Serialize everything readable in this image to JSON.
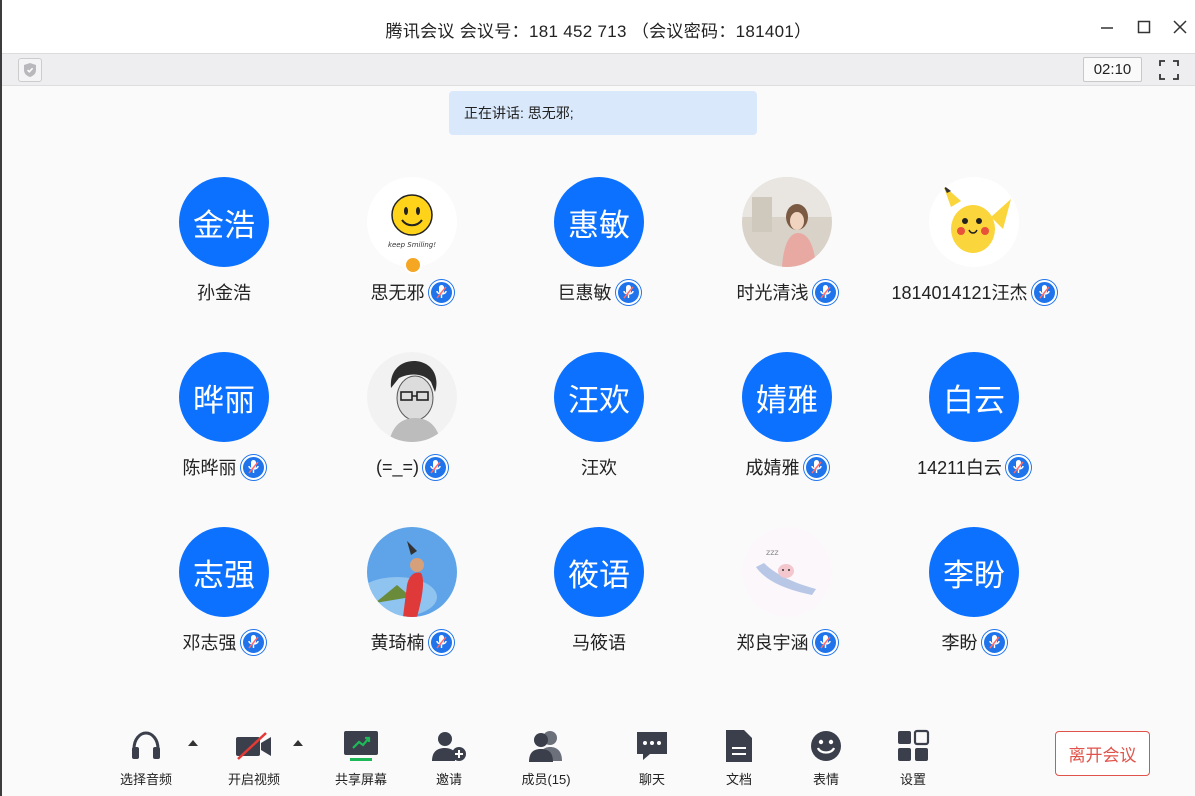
{
  "title": "腾讯会议 会议号：181 452 713 （会议密码：181401）",
  "timer": "02:10",
  "speaking": "正在讲话: 思无邪;",
  "participants": [
    {
      "avatar_text": "金浩",
      "name": "孙金浩",
      "avatar_type": "text",
      "mic": false
    },
    {
      "avatar_text": "",
      "name": "思无邪",
      "avatar_type": "smiley",
      "mic": true,
      "host_badge": true,
      "smile_caption": "keep Smiling!"
    },
    {
      "avatar_text": "惠敏",
      "name": "巨惠敏",
      "avatar_type": "text",
      "mic": true
    },
    {
      "avatar_text": "",
      "name": "时光清浅",
      "avatar_type": "photo-girl",
      "mic": true
    },
    {
      "avatar_text": "",
      "name": "1814014121汪杰",
      "avatar_type": "pikachu",
      "mic": true
    },
    {
      "avatar_text": "晔丽",
      "name": "陈晔丽",
      "avatar_type": "text",
      "mic": true
    },
    {
      "avatar_text": "",
      "name": "(=_=)",
      "avatar_type": "sketch-man",
      "mic": true
    },
    {
      "avatar_text": "汪欢",
      "name": "汪欢",
      "avatar_type": "text",
      "mic": false
    },
    {
      "avatar_text": "婧雅",
      "name": "成婧雅",
      "avatar_type": "text",
      "mic": true
    },
    {
      "avatar_text": "白云",
      "name": "14211白云",
      "avatar_type": "text",
      "mic": true
    },
    {
      "avatar_text": "志强",
      "name": "邓志强",
      "avatar_type": "text",
      "mic": true
    },
    {
      "avatar_text": "",
      "name": "黄琦楠",
      "avatar_type": "photo-sky",
      "mic": true
    },
    {
      "avatar_text": "筱语",
      "name": "马筱语",
      "avatar_type": "text",
      "mic": false
    },
    {
      "avatar_text": "",
      "name": "郑良宇涵",
      "avatar_type": "cartoon-pig",
      "mic": true
    },
    {
      "avatar_text": "李盼",
      "name": "李盼",
      "avatar_type": "text",
      "mic": true
    }
  ],
  "toolbar": {
    "audio": "选择音频",
    "video": "开启视频",
    "share": "共享屏幕",
    "invite": "邀请",
    "members": "成员(15)",
    "chat": "聊天",
    "docs": "文档",
    "emoji": "表情",
    "settings": "设置",
    "leave": "离开会议"
  },
  "colors": {
    "accent": "#0c71ff",
    "share_green": "#1fb858",
    "leave_red": "#e0534a",
    "speaking_bg": "#d9e8fb"
  }
}
